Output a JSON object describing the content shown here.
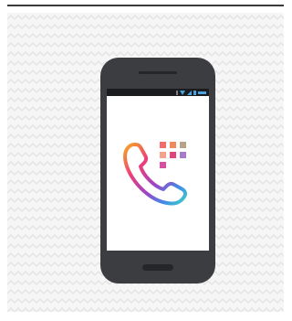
{
  "illustration": {
    "subject": "smartphone-with-dialer-app",
    "phone_body_color": "#3c3d41",
    "screen_color": "#ffffff",
    "status_bar_color": "#1b1c1f",
    "status_icon_color": "#4aa3df",
    "background_pattern": "chevron-zigzag",
    "background_color": "#f6f6f6",
    "top_rule_color": "#3a3a3a"
  },
  "app_icon": {
    "icon": "phone-handset-with-keypad-icon",
    "gradient_colors": [
      "#f5a623",
      "#ee3e78",
      "#9b45c9",
      "#3f8ee8",
      "#3fd1c4"
    ],
    "keypad_colors": [
      "#f26b6b",
      "#f08a5d",
      "#b8a38a",
      "#e0457b",
      "#a77bc9",
      "#d64fa3"
    ]
  }
}
